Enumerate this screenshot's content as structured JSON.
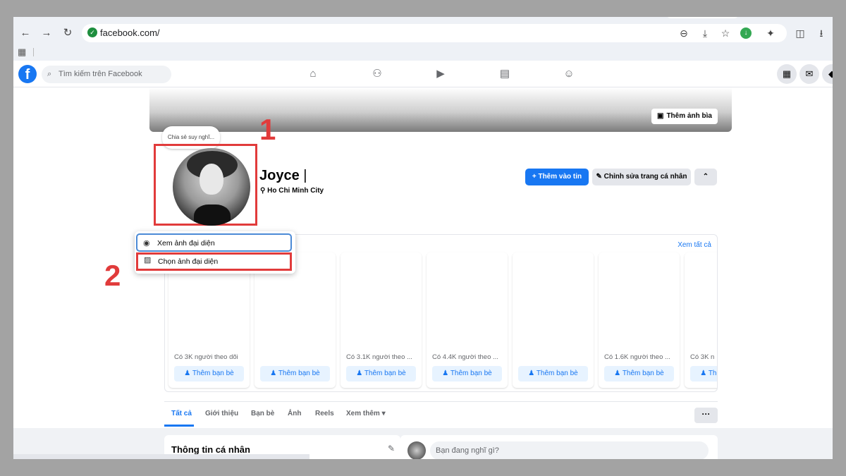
{
  "browser": {
    "url": "facebook.com/",
    "icons": [
      "back-icon",
      "forward-icon",
      "reload-icon",
      "lock-icon",
      "zoom-icon",
      "install-icon",
      "star-icon",
      "download-status-icon",
      "extensions-icon",
      "split-view-icon",
      "downloads-icon",
      "apps-icon"
    ]
  },
  "facebook": {
    "search_placeholder": "Tìm kiếm trên Facebook",
    "nav_icons": [
      "home-icon",
      "friends-icon",
      "video-icon",
      "marketplace-icon",
      "groups-icon"
    ]
  },
  "profile": {
    "cover_button": "Thêm ảnh bìa",
    "note_bubble": "Chia sẻ suy nghĩ...",
    "name": "Joyce",
    "location": "Ho Chi Minh City",
    "add_story": "Thêm vào tin",
    "edit_profile": "Chỉnh sửa trang cá nhân"
  },
  "annotations": {
    "step1": "1",
    "step2": "2",
    "color": "#e13b3b"
  },
  "avatar_menu": {
    "view": "Xem ảnh đại diện",
    "choose": "Chọn ảnh đại diện"
  },
  "people_you_may_know": {
    "see_all": "Xem tất cả",
    "add_label": "Thêm bạn bè",
    "cards": [
      {
        "followers": "Có 3K người theo dõi"
      },
      {
        "followers": ""
      },
      {
        "followers": "Có 3.1K người theo ..."
      },
      {
        "followers": "Có 4.4K người theo ..."
      },
      {
        "followers": ""
      },
      {
        "followers": "Có 1.6K người theo ..."
      },
      {
        "followers": "Có 3K n"
      }
    ]
  },
  "tabs": {
    "all": "Tất cả",
    "about": "Giới thiệu",
    "friends": "Bạn bè",
    "photos": "Ảnh",
    "reels": "Reels",
    "more": "Xem thêm",
    "more_button": "···"
  },
  "intro": {
    "title": "Thông tin cá nhân"
  },
  "composer": {
    "placeholder": "Bạn đang nghĩ gì?"
  },
  "colors": {
    "fb_blue": "#1877f2",
    "accent_red": "#e13b3b"
  }
}
